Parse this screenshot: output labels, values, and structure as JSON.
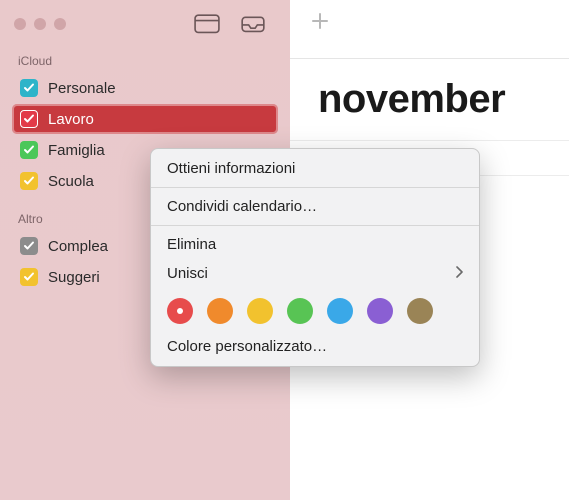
{
  "sidebar": {
    "sections": [
      {
        "label": "iCloud",
        "items": [
          {
            "label": "Personale",
            "color": "#2eb4c9",
            "checked": true,
            "selected": false
          },
          {
            "label": "Lavoro",
            "color": "#e23a48",
            "checked": true,
            "selected": true
          },
          {
            "label": "Famiglia",
            "color": "#4cc759",
            "checked": true,
            "selected": false
          },
          {
            "label": "Scuola",
            "color": "#f2c22e",
            "checked": true,
            "selected": false
          }
        ]
      },
      {
        "label": "Altro",
        "items": [
          {
            "label": "Complea",
            "color": "#8c8c8c",
            "checked": true,
            "selected": false
          },
          {
            "label": "Suggeri",
            "color": "#f2c22e",
            "checked": true,
            "selected": false
          }
        ]
      }
    ]
  },
  "main": {
    "title": "november"
  },
  "context_menu": {
    "items": [
      {
        "label": "Ottieni informazioni",
        "kind": "item"
      },
      {
        "kind": "sep"
      },
      {
        "label": "Condividi calendario…",
        "kind": "item"
      },
      {
        "kind": "sep"
      },
      {
        "label": "Elimina",
        "kind": "item"
      },
      {
        "label": "Unisci",
        "kind": "submenu"
      },
      {
        "kind": "colors"
      },
      {
        "label": "Colore personalizzato…",
        "kind": "item"
      }
    ],
    "colors": [
      {
        "hex": "#e74c4c",
        "selected": true
      },
      {
        "hex": "#f08a2c",
        "selected": false
      },
      {
        "hex": "#f2c22e",
        "selected": false
      },
      {
        "hex": "#58c454",
        "selected": false
      },
      {
        "hex": "#3aa8e8",
        "selected": false
      },
      {
        "hex": "#8a5fd3",
        "selected": false
      },
      {
        "hex": "#9a8456",
        "selected": false
      }
    ]
  }
}
